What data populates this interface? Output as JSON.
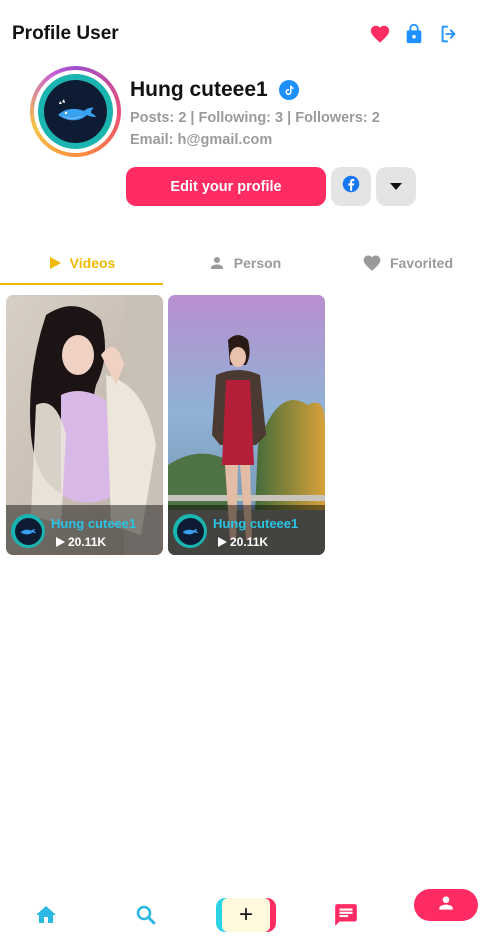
{
  "header": {
    "title": "Profile User",
    "icons": [
      "heart-icon",
      "lock-icon",
      "logout-icon"
    ],
    "colors": {
      "heart": "#fe2c62",
      "lock": "#1e90ff",
      "logout": "#1e90ff"
    }
  },
  "profile": {
    "username": "Hung cuteee1",
    "stats": "Posts: 2 | Following: 3 | Followers: 2",
    "email": "Email: h@gmail.com",
    "edit_button": "Edit your profile",
    "verified_icon": "tiktok-verified-icon"
  },
  "tabs": [
    {
      "label": "Videos",
      "icon": "play-icon",
      "active": true
    },
    {
      "label": "Person",
      "icon": "person-icon",
      "active": false
    },
    {
      "label": "Favorited",
      "icon": "heart-icon",
      "active": false
    }
  ],
  "videos": [
    {
      "author": "Hung cuteee1",
      "views": "20.11K"
    },
    {
      "author": "Hung cuteee1",
      "views": "20.11K"
    }
  ],
  "bottom_nav": [
    "home-icon",
    "search-icon",
    "add-icon",
    "chat-icon",
    "profile-icon"
  ],
  "add_label": "+",
  "colors": {
    "accent_pink": "#fe2c62",
    "accent_cyan": "#2bd4e4",
    "tab_active": "#f0b800"
  }
}
